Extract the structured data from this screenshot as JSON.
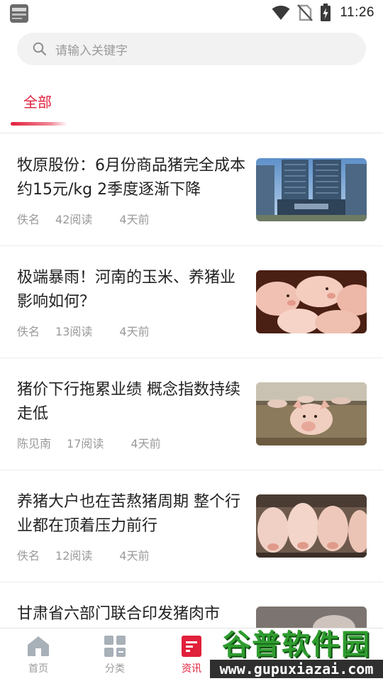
{
  "status_bar": {
    "time": "11:26",
    "icons": [
      "wifi-icon",
      "no-sim-icon",
      "battery-charging-icon"
    ]
  },
  "search": {
    "placeholder": "请输入关键字"
  },
  "tabs": [
    {
      "label": "全部",
      "active": true
    }
  ],
  "news": [
    {
      "title": "牧原股份：6月份商品猪完全成本约15元/kg 2季度逐渐下降",
      "author": "佚名",
      "reads": "42阅读",
      "time": "4天前",
      "thumb": "building-photo"
    },
    {
      "title": "极端暴雨！河南的玉米、养猪业影响如何？",
      "author": "佚名",
      "reads": "13阅读",
      "time": "4天前",
      "thumb": "piglets-photo"
    },
    {
      "title": "猪价下行拖累业绩 概念指数持续走低",
      "author": "陈见南",
      "reads": "17阅读",
      "time": "4天前",
      "thumb": "pig-farm-photo"
    },
    {
      "title": "养猪大户也在苦熬猪周期 整个行业都在顶着压力前行",
      "author": "佚名",
      "reads": "12阅读",
      "time": "4天前",
      "thumb": "pigs-pen-photo"
    },
    {
      "title": "甘肃省六部门联合印发猪肉市",
      "author": "",
      "reads": "",
      "time": "",
      "thumb": "pig-photo"
    }
  ],
  "bottom_nav": [
    {
      "label": "首页",
      "icon": "home-icon",
      "active": false
    },
    {
      "label": "分类",
      "icon": "category-icon",
      "active": false
    },
    {
      "label": "资讯",
      "icon": "news-icon",
      "active": true
    }
  ],
  "watermark": {
    "title": "谷普软件园",
    "url": "www.gupuxiazai.com"
  },
  "colors": {
    "accent": "#e1203b",
    "muted": "#9a9a9a"
  }
}
